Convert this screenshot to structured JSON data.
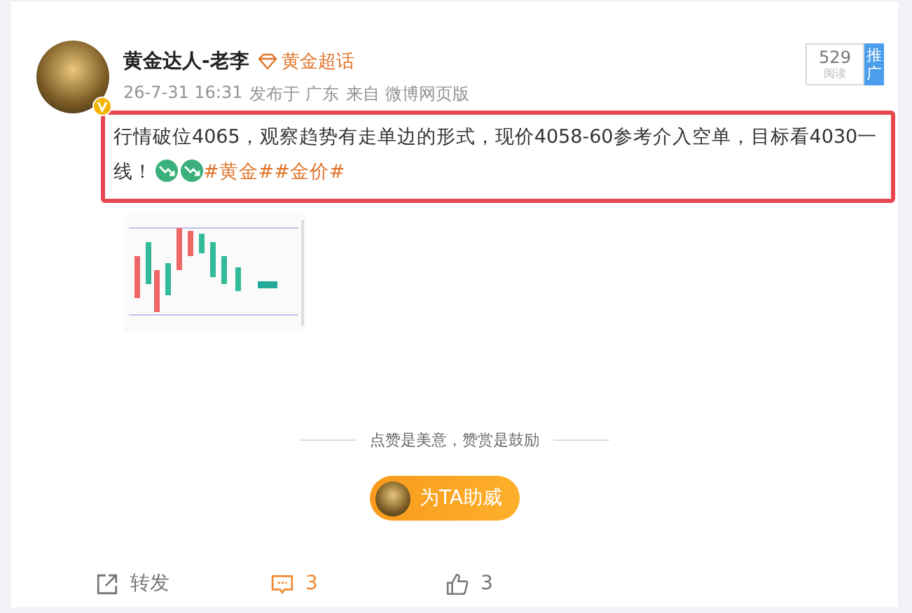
{
  "post": {
    "author": {
      "name": "黄金达人-老李",
      "verified": true,
      "badge": "黄金超话"
    },
    "meta": {
      "time": "26-7-31 16:31",
      "location": "发布于 广东",
      "source": "来自 微博网页版"
    },
    "read": {
      "count": "529",
      "label": "阅读",
      "promote": "推广"
    },
    "body": {
      "text": "行情破位4065，观察趋势有走单边的形式，现价4058-60参考介入空单，目标看4030一线！",
      "hashtags": [
        "#黄金#",
        "#金价#"
      ],
      "highlighted": true
    },
    "reward": {
      "slogan": "点赞是美意，赞赏是鼓励",
      "button": "为TA助威"
    },
    "actions": [
      {
        "kind": "repost",
        "label": "转发",
        "selected": false
      },
      {
        "kind": "comment",
        "label": "3",
        "selected": true
      },
      {
        "kind": "like",
        "label": "3",
        "selected": false
      }
    ]
  }
}
